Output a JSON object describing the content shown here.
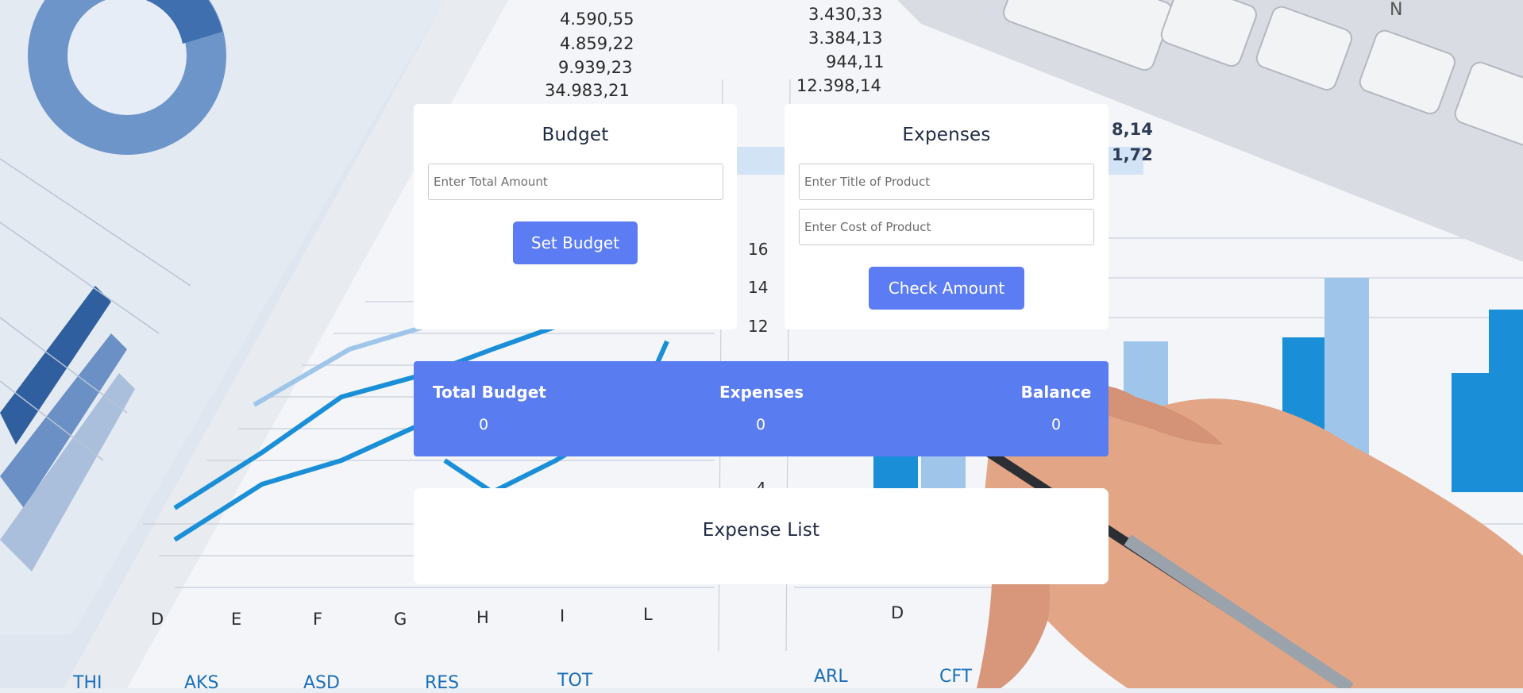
{
  "budget": {
    "title": "Budget",
    "amount_placeholder": "Enter Total Amount",
    "set_button": "Set Budget"
  },
  "expenses_form": {
    "title": "Expenses",
    "title_placeholder": "Enter Title of Product",
    "cost_placeholder": "Enter Cost of Product",
    "check_button": "Check Amount"
  },
  "summary": {
    "total_budget_label": "Total Budget",
    "total_budget_value": "0",
    "expenses_label": "Expenses",
    "expenses_value": "0",
    "balance_label": "Balance",
    "balance_value": "0"
  },
  "expense_list": {
    "title": "Expense List"
  },
  "background": {
    "numbers_left": [
      "4.590,55",
      "4.859,22",
      "9.939,23",
      "34.983,21"
    ],
    "numbers_right": [
      "3.430,33",
      "3.384,13",
      "944,11",
      "12.398,14"
    ],
    "side_numbers": [
      "8,14",
      "1,72"
    ],
    "axis_ticks": [
      "16",
      "14",
      "12",
      "4"
    ],
    "column_letters": [
      "D",
      "E",
      "F",
      "G",
      "H",
      "I",
      "L",
      "D"
    ],
    "bottom_labels": [
      "THI",
      "AKS",
      "ASD",
      "RES",
      "TOT",
      "ARL",
      "CFT"
    ],
    "keyboard_keys": [
      "N"
    ],
    "colors": {
      "brand": "#597cf1",
      "chart_blue": "#1a8fd8",
      "chart_light": "#9fc6ea"
    }
  }
}
